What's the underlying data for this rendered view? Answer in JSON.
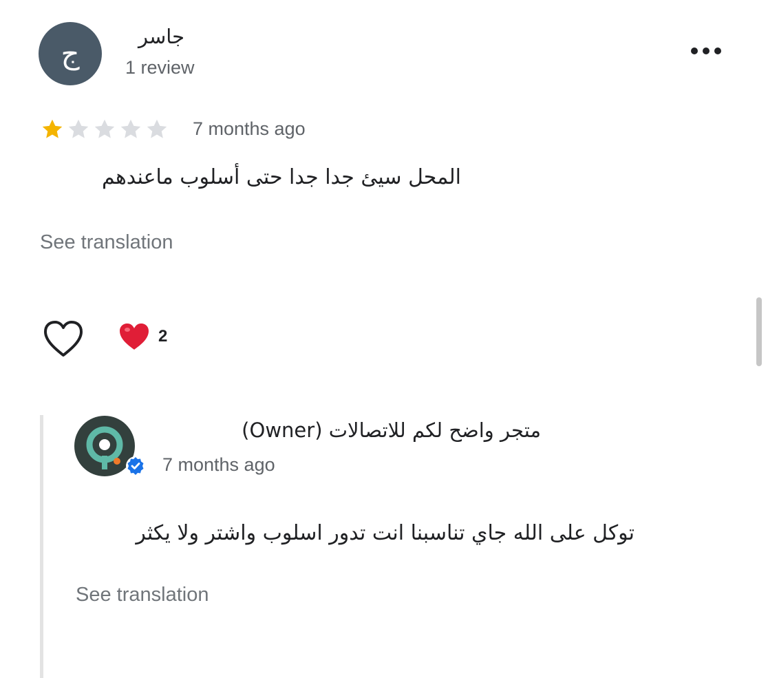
{
  "review": {
    "avatar_letter": "ج",
    "avatar_color": "#4a5a68",
    "reviewer_name": "جاسر",
    "review_count": "1 review",
    "rating": 1,
    "rating_max": 5,
    "time": "7 months ago",
    "text": "المحل سيئ جدا جدا حتى أسلوب ماعندهم",
    "see_translation": "See translation",
    "like_icon": "heart-outline-icon",
    "reaction_icon": "red-heart-icon",
    "reaction_count": "2",
    "menu_icon": "more-horizontal-icon"
  },
  "owner_reply": {
    "name": "متجر واضح لكم للاتصالات (Owner)",
    "time": "7 months ago",
    "text": "توكل على الله جاي تناسبنا انت تدور اسلوب واشتر ولا يكثر",
    "see_translation": "See translation",
    "verified_icon": "verified-badge-icon"
  },
  "colors": {
    "star_filled": "#f4b400",
    "star_empty": "#dadce0",
    "verified": "#1a73e8",
    "reaction": "#e01e37"
  }
}
